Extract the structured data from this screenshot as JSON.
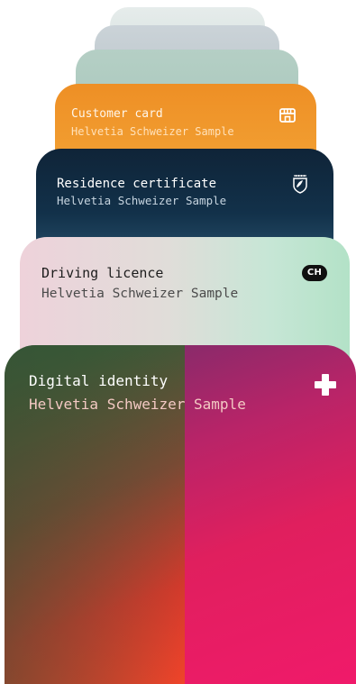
{
  "cards": [
    {
      "id": "customer",
      "title": "Customer card",
      "subtitle": "Helvetia Schweizer Sample",
      "icon": "shop-icon",
      "color": "#ee8f25"
    },
    {
      "id": "residence",
      "title": "Residence certificate",
      "subtitle": "Helvetia Schweizer Sample",
      "icon": "coat-of-arms-icon",
      "color": "#0f2438"
    },
    {
      "id": "driving",
      "title": "Driving licence",
      "subtitle": "Helvetia Schweizer Sample",
      "badge": "CH",
      "color": "#c7e6d6"
    },
    {
      "id": "digital",
      "title": "Digital identity",
      "subtitle": "Helvetia Schweizer Sample",
      "icon": "swiss-cross-icon",
      "color": "#e01f5e"
    }
  ]
}
